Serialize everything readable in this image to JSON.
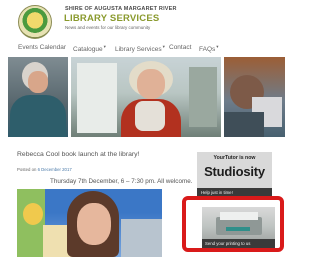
{
  "header": {
    "org_name": "SHIRE OF AUGUSTA MARGARET RIVER",
    "site_title": "LIBRARY SERVICES",
    "tagline": "News and events for our library community"
  },
  "nav": {
    "items": [
      {
        "label": "Events Calendar",
        "has_dropdown": false
      },
      {
        "label": "Catalogue",
        "has_dropdown": true
      },
      {
        "label": "Library Services",
        "has_dropdown": true
      },
      {
        "label": "Contact",
        "has_dropdown": false
      },
      {
        "label": "FAQs",
        "has_dropdown": true
      }
    ],
    "caret": "▾"
  },
  "post": {
    "title": "Rebecca Cool book launch at the library!",
    "meta_prefix": "Posted on",
    "meta_date": "6 December 2017",
    "event_line": "Thursday 7th December, 6 – 7:30 pm. All welcome."
  },
  "sidebar": {
    "studiosity": {
      "small_text": "YourTutor is now",
      "brand": "Studiosity",
      "bar_text": "Help just in time!"
    },
    "printing": {
      "bar_text": "Send your printing to us"
    }
  },
  "colors": {
    "title_green": "#8a9a2d",
    "highlight_red": "#d91a1a",
    "link_blue": "#4a79a8"
  }
}
